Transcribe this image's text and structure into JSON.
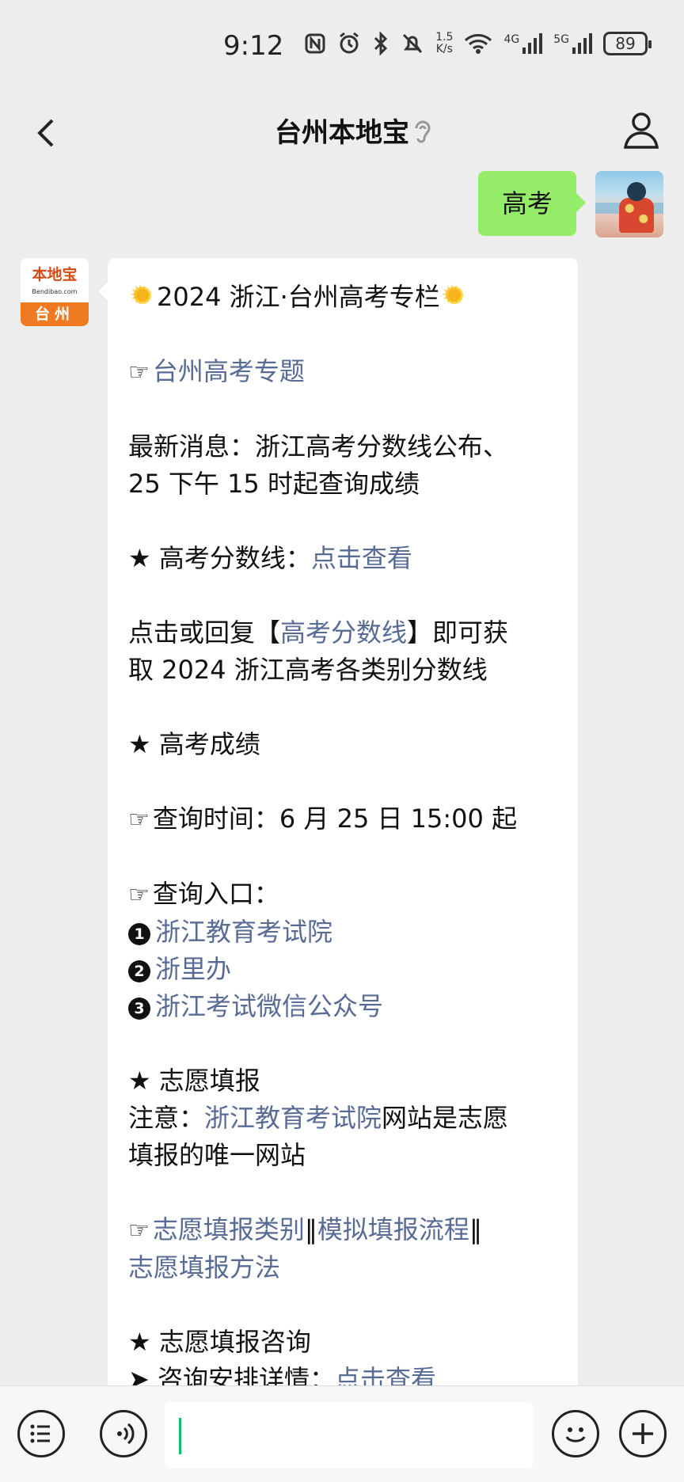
{
  "status_bar": {
    "time": "9:12",
    "speed_value": "1.5",
    "speed_unit": "K/s",
    "network_4g": "4G",
    "network_5g": "5G",
    "battery": "89"
  },
  "nav": {
    "title": "台州本地宝"
  },
  "chat": {
    "user_message": "高考",
    "bot_avatar": {
      "logo_text": "本地宝",
      "logo_url": "Bendibao.com",
      "logo_city": "台州"
    },
    "bot_message": {
      "headline": "2024 浙江·台州高考专栏",
      "topic_link": "台州高考专题",
      "news_line1": "最新消息：浙江高考分数线公布、",
      "news_line2": "25 下午 15 时起查询成绩",
      "score_label": "★ 高考分数线：",
      "score_link": "点击查看",
      "reply_prefix": "点击或回复【",
      "reply_link": "高考分数线",
      "reply_suffix": "】即可获",
      "reply_line2": "取 2024 浙江高考各类别分数线",
      "results_heading": "★ 高考成绩",
      "query_time": "查询时间：6 月 25 日 15:00 起",
      "query_entry": "查询入口：",
      "entries": [
        {
          "num": "1",
          "text": "浙江教育考试院"
        },
        {
          "num": "2",
          "text": "浙里办"
        },
        {
          "num": "3",
          "text": "浙江考试微信公众号"
        }
      ],
      "volunteer_heading": "★ 志愿填报",
      "notice_prefix": "注意：",
      "notice_link": "浙江教育考试院",
      "notice_suffix": "网站是志愿",
      "notice_line2": "填报的唯一网站",
      "link_category": "志愿填报类别",
      "separator": "‖",
      "link_process": "模拟填报流程",
      "link_method": "志愿填报方法",
      "consult_heading": "★ 志愿填报咨询",
      "consult_label": "➤ 咨询安排详情：",
      "consult_link": "点击查看"
    }
  }
}
